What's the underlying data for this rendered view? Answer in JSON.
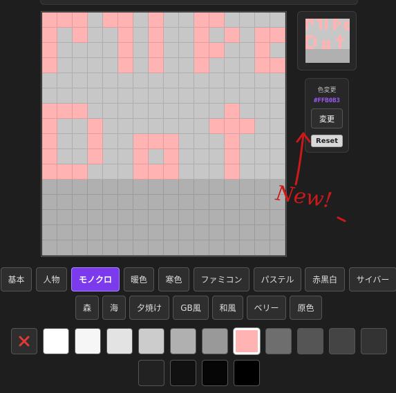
{
  "canvas": {
    "colors": {
      ".": "#c7c7c7",
      "p": "#ffb3b3",
      "g": "#b0b0b0"
    },
    "rows": [
      "ppp.pp.p..pp....",
      "p.p..p.p..p.p.pp",
      "p....p.p..pp..p.",
      "p....p.p..p...pp",
      "................",
      "................",
      "ppp.........p...",
      "p..p.......ppp..",
      "p..p..ppp...p...",
      "p..p..p.p...p...",
      "ppp...ppp...p...",
      "gggggggggggggggg",
      "gggggggggggggggg",
      "gggggggggggggggg",
      "gggggggggggggggg",
      "gggggggggggggggg"
    ]
  },
  "color_panel": {
    "title": "色変更",
    "hex": "#FFB0B3",
    "change_label": "変更",
    "reset_label": "Reset"
  },
  "annotation": {
    "text": "New!",
    "color": "#cc1a1a"
  },
  "tabs": [
    "基本",
    "人物",
    "モノクロ",
    "暖色",
    "寒色",
    "ファミコン",
    "パステル",
    "赤黒白",
    "サイバー",
    "森",
    "海",
    "夕焼け",
    "GB風",
    "和風",
    "ベリー",
    "原色"
  ],
  "active_tab": "モノクロ",
  "palette": {
    "clear_icon": "close-icon",
    "clear_color": "#e53935",
    "colors": [
      "#ffffff",
      "#f6f6f6",
      "#e3e3e3",
      "#cccccc",
      "#b0b0b0",
      "#999999",
      "#ffb3b3",
      "#6e6e6e",
      "#555555",
      "#444444",
      "#333333",
      "#222222",
      "#111111",
      "#060606",
      "#000000"
    ],
    "selected": "#ffb3b3"
  }
}
